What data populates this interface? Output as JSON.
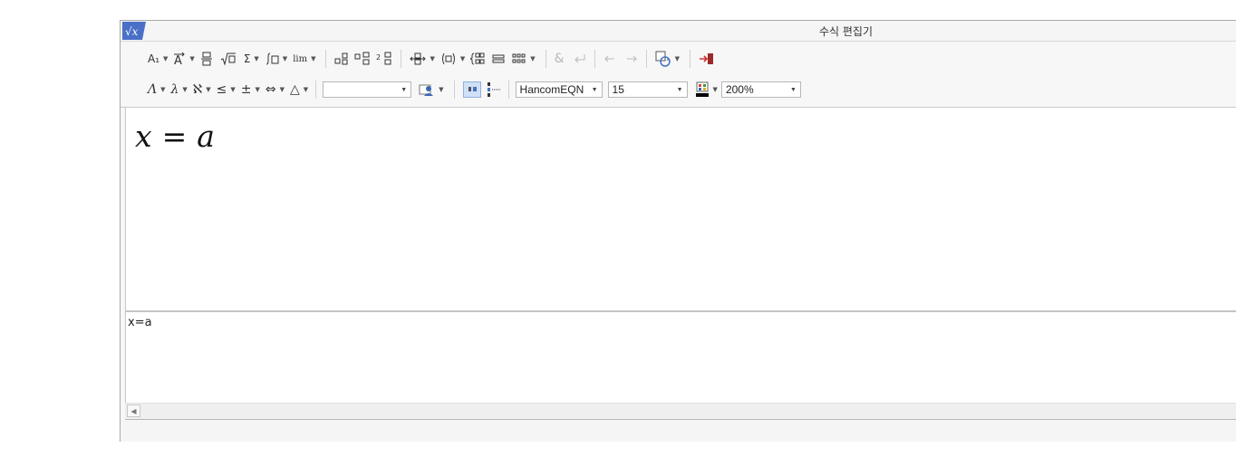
{
  "window": {
    "title": "수식 편집기"
  },
  "toolbar": {
    "row1": {
      "format_label": "A₁",
      "sum_label": "Σ",
      "limit_label": "lim"
    },
    "row2": {
      "greek_upper_label": "Λ",
      "greek_lower_label": "λ",
      "special_label": "ℵ",
      "relation_label": "≤",
      "operator_label": "±",
      "arrow_label": "⇔",
      "misc_label": "△",
      "font_value": "HancomEQN",
      "size_value": "15",
      "zoom_value": "200%",
      "history_value": ""
    }
  },
  "editor": {
    "formula_lhs": "x",
    "formula_eq": "=",
    "formula_rhs": "a"
  },
  "script": {
    "text": "x=a"
  },
  "colors": {
    "accent": "#4472c4",
    "window_bg": "#f7f7f7",
    "border": "#a9a9a9"
  }
}
